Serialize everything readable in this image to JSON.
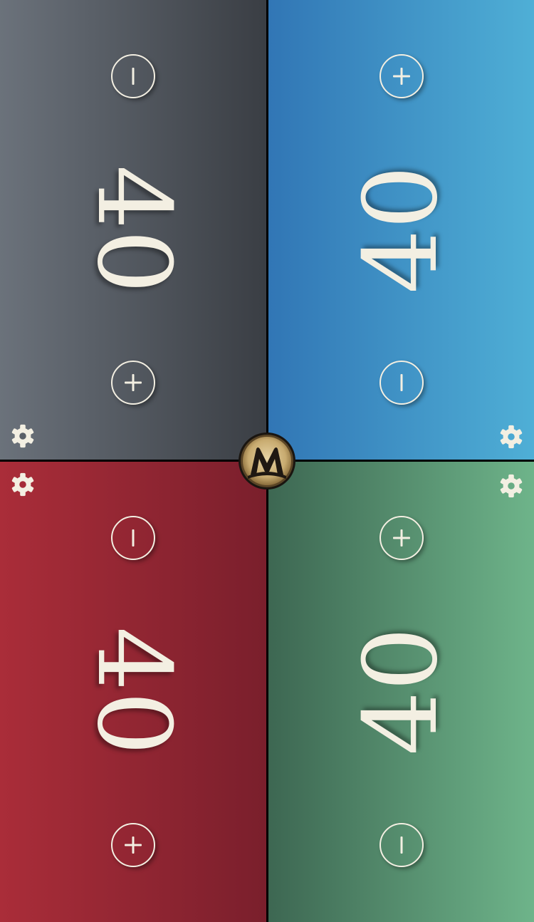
{
  "players": [
    {
      "id": "top-left",
      "life": "40",
      "color": "#5b616b",
      "gradient": [
        "#6b727b",
        "#3a3e44"
      ],
      "buttons": [
        "minus",
        "plus"
      ]
    },
    {
      "id": "top-right",
      "life": "40",
      "color": "#3f8ec3",
      "gradient": [
        "#3176b5",
        "#4fafd6"
      ],
      "buttons": [
        "plus",
        "minus"
      ]
    },
    {
      "id": "bottom-left",
      "life": "40",
      "color": "#962533",
      "gradient": [
        "#aa2d39",
        "#7a1f2c"
      ],
      "buttons": [
        "minus",
        "plus"
      ]
    },
    {
      "id": "bottom-right",
      "life": "40",
      "color": "#56906a",
      "gradient": [
        "#3d6752",
        "#6eb48a"
      ],
      "buttons": [
        "plus",
        "minus"
      ]
    }
  ],
  "icons": {
    "settings": "gear-icon",
    "increment": "plus-icon",
    "decrement": "minus-icon",
    "center": "planeswalker-logo"
  },
  "colors": {
    "text": "#f3efe2",
    "divider": "#000000",
    "logo_gold": "#d8bf87"
  }
}
